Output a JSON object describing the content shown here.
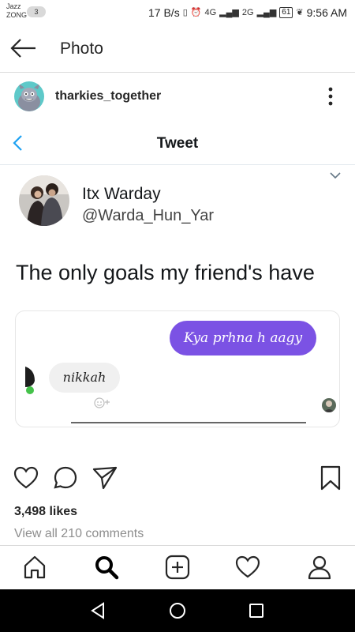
{
  "status_bar": {
    "carrier_line1": "Jazz",
    "carrier_line2": "ZONG",
    "sim_badge": "3",
    "speed": "17 B/s",
    "network_4g": "4G",
    "network_2g": "2G",
    "battery": "61",
    "time": "9:56 AM"
  },
  "header": {
    "title": "Photo"
  },
  "post": {
    "username": "tharkies_together",
    "likes": "3,498 likes",
    "view_comments": "View all 210 comments"
  },
  "tweet": {
    "bar_title": "Tweet",
    "author_name": "Itx Warday",
    "author_handle": "@Warda_Hun_Yar",
    "text": "The only goals my friend's have",
    "chat": {
      "sent_message": "Kya prhna h aagy",
      "received_message": "nikkah"
    }
  },
  "icons": {
    "back": "arrow-left-icon",
    "more": "vertical-dots-icon",
    "tweet_back": "chevron-left-icon",
    "tweet_menu": "chevron-down-icon",
    "like": "heart-icon",
    "comment": "comment-icon",
    "share": "paper-plane-icon",
    "save": "bookmark-icon",
    "home": "home-icon",
    "search": "search-icon",
    "add": "add-post-icon",
    "activity": "heart-icon",
    "profile": "profile-icon"
  },
  "colors": {
    "sent_bubble": "#7b52e4",
    "received_bubble": "#f0f0f0",
    "online_dot": "#44c24a"
  }
}
